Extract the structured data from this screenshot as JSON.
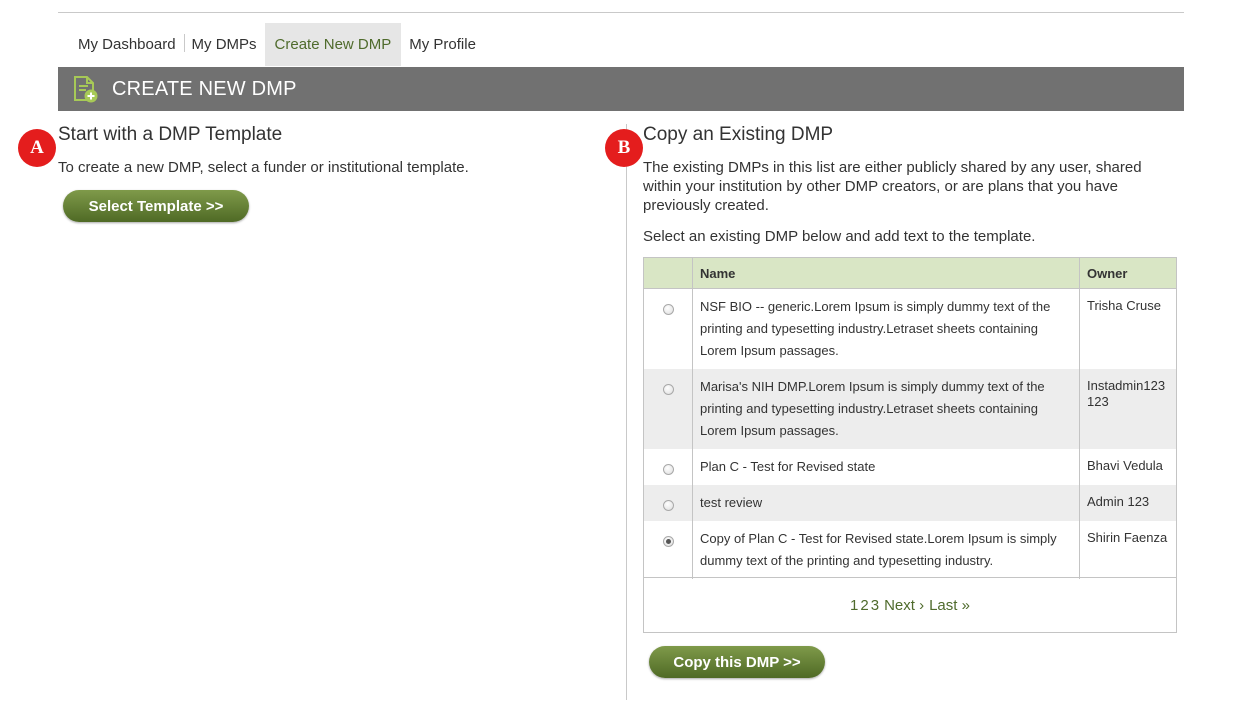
{
  "nav": {
    "items": [
      {
        "label": "My Dashboard"
      },
      {
        "label": "My DMPs"
      },
      {
        "label": "Create New DMP"
      },
      {
        "label": "My Profile"
      }
    ]
  },
  "header": {
    "title": "CREATE NEW DMP",
    "icon": "document-add-icon"
  },
  "badges": {
    "a": "A",
    "b": "B"
  },
  "template_section": {
    "title": "Start with a DMP Template",
    "description": "To create a new DMP, select a funder or institutional template.",
    "button_label": "Select Template >>"
  },
  "copy_section": {
    "title": "Copy an Existing DMP",
    "description": "The existing DMPs in this list are either publicly shared by any user, shared within your institution by other DMP creators, or are plans that you have previously created.",
    "instruction": "Select an existing DMP below and add text to the template.",
    "table": {
      "headers": {
        "name": "Name",
        "owner": "Owner"
      },
      "rows": [
        {
          "name": "NSF BIO -- generic.Lorem Ipsum is simply dummy text of the printing and typesetting industry.Letraset sheets containing Lorem Ipsum passages.",
          "owner": "Trisha Cruse",
          "selected": false
        },
        {
          "name": "Marisa's NIH DMP.Lorem Ipsum is simply dummy text of the printing and typesetting industry.Letraset sheets containing Lorem Ipsum passages.",
          "owner": "Instadmin123 123",
          "selected": false
        },
        {
          "name": "Plan C - Test for Revised state",
          "owner": "Bhavi Vedula",
          "selected": false
        },
        {
          "name": "test review",
          "owner": "Admin 123",
          "selected": false
        },
        {
          "name": "Copy of Plan C - Test for Revised state.Lorem Ipsum is simply dummy text of the printing and typesetting industry.",
          "owner": "Shirin Faenza",
          "selected": true
        }
      ]
    },
    "pagination": {
      "pages": [
        "1",
        "2",
        "3"
      ],
      "next": "Next ›",
      "last": "Last »"
    },
    "button_label": "Copy this DMP >>"
  },
  "colors": {
    "accent_green": "#5f7a33",
    "header_gray": "#717171",
    "badge_red": "#e41d1d",
    "table_header": "#d9e6c5"
  }
}
